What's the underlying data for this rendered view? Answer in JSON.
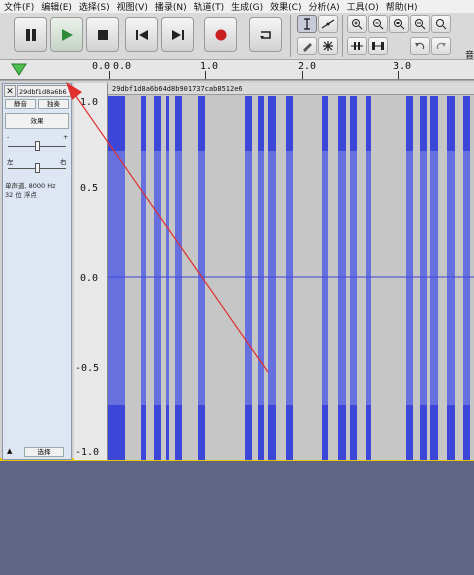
{
  "menu": {
    "items": [
      {
        "label": "文件(F)"
      },
      {
        "label": "编辑(E)"
      },
      {
        "label": "选择(S)"
      },
      {
        "label": "视图(V)"
      },
      {
        "label": "播录(N)"
      },
      {
        "label": "轨道(T)"
      },
      {
        "label": "生成(G)"
      },
      {
        "label": "效果(C)"
      },
      {
        "label": "分析(A)"
      },
      {
        "label": "工具(O)"
      },
      {
        "label": "帮助(H)"
      }
    ]
  },
  "toolbar": {
    "transport": [
      {
        "name": "pause-button",
        "icon": "pause-icon"
      },
      {
        "name": "play-button",
        "icon": "play-icon"
      },
      {
        "name": "stop-button",
        "icon": "stop-icon"
      },
      {
        "name": "skip-start-button",
        "icon": "skip-start-icon"
      },
      {
        "name": "skip-end-button",
        "icon": "skip-end-icon"
      },
      {
        "name": "record-button",
        "icon": "record-icon"
      },
      {
        "name": "loop-button",
        "icon": "loop-icon"
      }
    ],
    "volume_label": "音",
    "colors": {
      "play": "#2f8a3a",
      "record": "#c82020"
    }
  },
  "timeline": {
    "labels": [
      "0.0",
      "0.0",
      "1.0",
      "2.0",
      "3.0"
    ]
  },
  "track": {
    "name": "29dbf1d8a6b6",
    "clip_title": "29dbf1d8a6b64d8b901737cab8512e6",
    "mute_label": "静音",
    "solo_label": "独奏",
    "effects_label": "效果",
    "gain_minus": "-",
    "gain_plus": "+",
    "pan_left": "左",
    "pan_right": "右",
    "info_line1": "单声道, 8000 Hz",
    "info_line2": "32 位 浮点",
    "select_label": "选择",
    "amplitude_labels": [
      "1.0",
      "0.5",
      "0.0",
      "-0.5",
      "-1.0"
    ],
    "colors": {
      "waveform": "#3c46d8",
      "waveform_light": "#6670de",
      "background": "#c6c6c6",
      "selection_border": "#e6c600"
    }
  },
  "annotation": {
    "color": "#e03030"
  }
}
